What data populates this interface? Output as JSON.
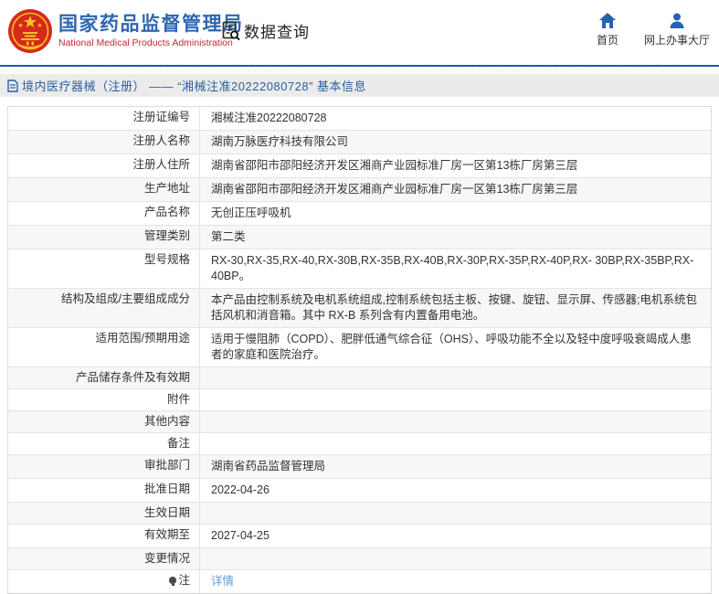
{
  "header": {
    "brand": {
      "emblem_icon": "china-national-emblem-icon",
      "title_cn": "国家药品监督管理局",
      "title_en": "National Medical Products Administration"
    },
    "section": {
      "icon": "document-search-icon",
      "label": "数据查询"
    },
    "nav": [
      {
        "icon": "home-icon",
        "label": "首页"
      },
      {
        "icon": "user-icon",
        "label": "网上办事大厅"
      }
    ]
  },
  "breadcrumb": {
    "icon": "document-icon",
    "text": "境内医疗器械（注册） —— “湘械注准20222080728” 基本信息"
  },
  "table": {
    "rows": [
      {
        "label": "注册证编号",
        "value": "湘械注准20222080728"
      },
      {
        "label": "注册人名称",
        "value": "湖南万脉医疗科技有限公司"
      },
      {
        "label": "注册人住所",
        "value": "湖南省邵阳市邵阳经济开发区湘商产业园标准厂房一区第13栋厂房第三层"
      },
      {
        "label": "生产地址",
        "value": "湖南省邵阳市邵阳经济开发区湘商产业园标准厂房一区第13栋厂房第三层"
      },
      {
        "label": "产品名称",
        "value": "无创正压呼吸机"
      },
      {
        "label": "管理类别",
        "value": "第二类"
      },
      {
        "label": "型号规格",
        "value": "RX-30,RX-35,RX-40,RX-30B,RX-35B,RX-40B,RX-30P,RX-35P,RX-40P,RX- 30BP,RX-35BP,RX-40BP。"
      },
      {
        "label": "结构及组成/主要组成成分",
        "value": "本产品由控制系统及电机系统组成,控制系统包括主板、按键、旋钮、显示屏、传感器;电机系统包括风机和消音箱。其中 RX-B 系列含有内置备用电池。"
      },
      {
        "label": "适用范围/预期用途",
        "value": "适用于慢阻肺（COPD）、肥胖低通气综合征（OHS）、呼吸功能不全以及轻中度呼吸衰竭成人患者的家庭和医院治疗。"
      },
      {
        "label": "产品储存条件及有效期",
        "value": ""
      },
      {
        "label": "附件",
        "value": ""
      },
      {
        "label": "其他内容",
        "value": ""
      },
      {
        "label": "备注",
        "value": ""
      },
      {
        "label": "审批部门",
        "value": "湖南省药品监督管理局"
      },
      {
        "label": "批准日期",
        "value": "2022-04-26"
      },
      {
        "label": "生效日期",
        "value": ""
      },
      {
        "label": "有效期至",
        "value": "2027-04-25"
      },
      {
        "label": "变更情况",
        "value": ""
      },
      {
        "label": "注",
        "label_icon": "lightbulb-icon",
        "value": "详情",
        "link": true
      }
    ]
  },
  "colors": {
    "brand_blue": "#2e66b0",
    "brand_red": "#c9252d",
    "nav_icon_blue": "#2263b4",
    "header_rule_blue": "#1b5cab",
    "breadcrumb_bg": "#ebebeb",
    "breadcrumb_text": "#2a5f9e",
    "table_border": "#e4e4e4",
    "row_alt_bg": "#f7f7f7",
    "link_blue": "#5b9bd5"
  }
}
